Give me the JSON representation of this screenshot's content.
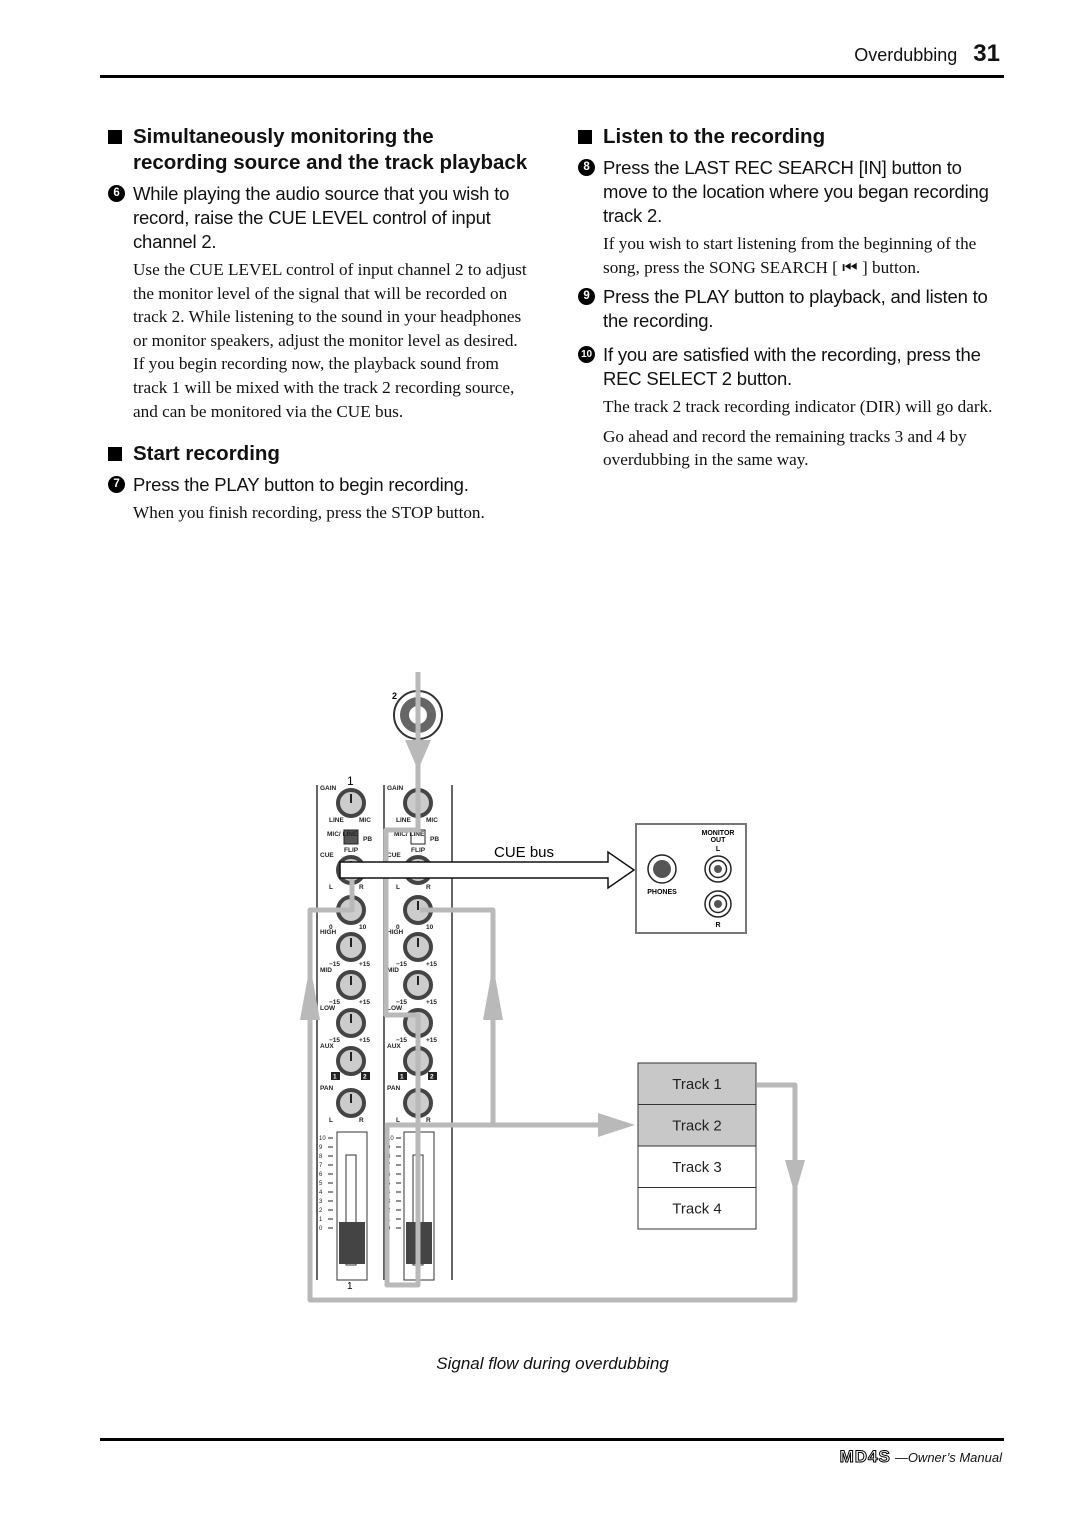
{
  "header": {
    "section": "Overdubbing",
    "page": "31"
  },
  "left": {
    "heading1": "Simultaneously monitoring the recording source and the track playback",
    "step6": {
      "num": "6",
      "text": "While playing the audio source that you wish to record, raise the CUE LEVEL control of input channel 2.",
      "body": "Use the CUE LEVEL control of input channel 2 to adjust the monitor level of the signal that will be recorded on track 2. While listening to the sound in your headphones or monitor speakers, adjust the monitor level as desired. If you begin recording now, the playback sound from track 1 will be mixed with the track 2 recording source, and can be monitored via the CUE bus."
    },
    "heading2": "Start recording",
    "step7": {
      "num": "7",
      "text": "Press the PLAY button to begin recording.",
      "body": "When you finish recording, press the STOP button."
    }
  },
  "right": {
    "heading": "Listen to the recording",
    "step8": {
      "num": "8",
      "text": "Press the LAST REC SEARCH [IN] button to move to the location where you began recording track 2.",
      "body": "If you wish to start listening from the beginning of the song, press the SONG SEARCH [ ⏮ ] button."
    },
    "step9": {
      "num": "9",
      "text": "Press the PLAY button to playback, and listen to the recording."
    },
    "step10": {
      "num": "10",
      "text": "If you are satisfied with the recording, press the REC SELECT 2 button.",
      "body1": "The track 2 track recording indicator (DIR) will go dark.",
      "body2": "Go ahead and record the remaining tracks 3 and 4 by overdubbing in the same way."
    }
  },
  "diagram": {
    "input_jack_label": "2",
    "channel1_label": "1",
    "channel1_bottom": "1",
    "knob_labels": [
      "GAIN",
      "CUE",
      "HIGH",
      "MID",
      "LOW",
      "AUX",
      "PAN"
    ],
    "gain_range": [
      "LINE",
      "MIC"
    ],
    "eq_range": [
      "−15",
      "+15"
    ],
    "level_range": [
      "0",
      "10"
    ],
    "pan_range": [
      "L",
      "R"
    ],
    "flip": {
      "left": "MIC/ LINE",
      "button": "FLIP",
      "right": "PB"
    },
    "aux_buttons": [
      "1",
      "2"
    ],
    "fader_scale": [
      "10",
      "9",
      "8",
      "7",
      "6",
      "5",
      "4",
      "3",
      "2",
      "1",
      "0"
    ],
    "cue_bus_label": "CUE bus",
    "monitor_panel": {
      "phones": "PHONES",
      "monitor_out": "MONITOR",
      "monitor_out2": "OUT",
      "left": "L",
      "right": "R"
    },
    "tracks": [
      "Track 1",
      "Track 2",
      "Track 3",
      "Track 4"
    ],
    "track_fill_colors": [
      "#c8c8c8",
      "#c8c8c8",
      "#ffffff",
      "#ffffff"
    ],
    "signal_color": "#b9b9b9"
  },
  "caption": "Signal flow during overdubbing",
  "footer": {
    "logo": "MD4S",
    "manual": "—Owner’s Manual"
  }
}
